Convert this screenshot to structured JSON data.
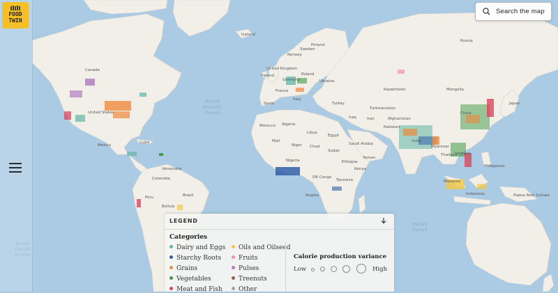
{
  "brand": {
    "logo_line1": "FOOD",
    "logo_line2": "TWIN"
  },
  "search": {
    "label": "Search the map",
    "icon": "search-icon"
  },
  "menu": {
    "icon": "hamburger-menu-icon"
  },
  "map": {
    "ocean_labels": [
      {
        "id": "north-atlantic",
        "lines": [
          "North",
          "Atlantic",
          "Ocean"
        ]
      },
      {
        "id": "south-pacific",
        "lines": [
          "South",
          "Pacific",
          "Ocean"
        ]
      },
      {
        "id": "indian",
        "lines": [
          "Indian",
          "Ocean"
        ]
      }
    ],
    "place_labels": [
      "Canada",
      "United States",
      "Mexico",
      "Cuba",
      "Colombia",
      "Venezuela",
      "Peru",
      "Brazil",
      "Bolivia",
      "Iceland",
      "Sweden",
      "Norway",
      "Finland",
      "United Kingdom",
      "Ireland",
      "Germany",
      "Poland",
      "Ukraine",
      "France",
      "Spain",
      "Italy",
      "Morocco",
      "Algeria",
      "Libya",
      "Egypt",
      "Mali",
      "Niger",
      "Chad",
      "Sudan",
      "Nigeria",
      "Ethiopia",
      "DR Congo",
      "Tanzania",
      "Angola",
      "Kenya",
      "Turkey",
      "Iraq",
      "Iran",
      "Saudi Arabia",
      "Yemen",
      "Turkmenistan",
      "Afghanistan",
      "Pakistan",
      "India",
      "Kazakhstan",
      "Mongolia",
      "China",
      "Japan",
      "Myanmar",
      "Thailand",
      "Vietnam",
      "Philippines",
      "Malaysia",
      "Indonesia",
      "Papua New Guinea",
      "Russia"
    ]
  },
  "legend": {
    "title": "LEGEND",
    "toggle_icon": "arrow-down-icon",
    "categories_title": "Categories",
    "categories": [
      {
        "label": "Dairy and Eggs",
        "color": "#5fb6a4"
      },
      {
        "label": "Oils and Oilseed",
        "color": "#f2c94c"
      },
      {
        "label": "Starchy Roots",
        "color": "#2f5fa7"
      },
      {
        "label": "Fruits",
        "color": "#f08fb7"
      },
      {
        "label": "Grains",
        "color": "#ef8a3c"
      },
      {
        "label": "Pulses",
        "color": "#b27fc3"
      },
      {
        "label": "Vegetables",
        "color": "#3f9a46"
      },
      {
        "label": "Treenuts",
        "color": "#8c6652"
      },
      {
        "label": "Meat and Fish",
        "color": "#d9465c"
      },
      {
        "label": "Other",
        "color": "#a0a0a0"
      }
    ],
    "variance": {
      "title": "Calorie production variance",
      "low": "Low",
      "high": "High"
    }
  }
}
